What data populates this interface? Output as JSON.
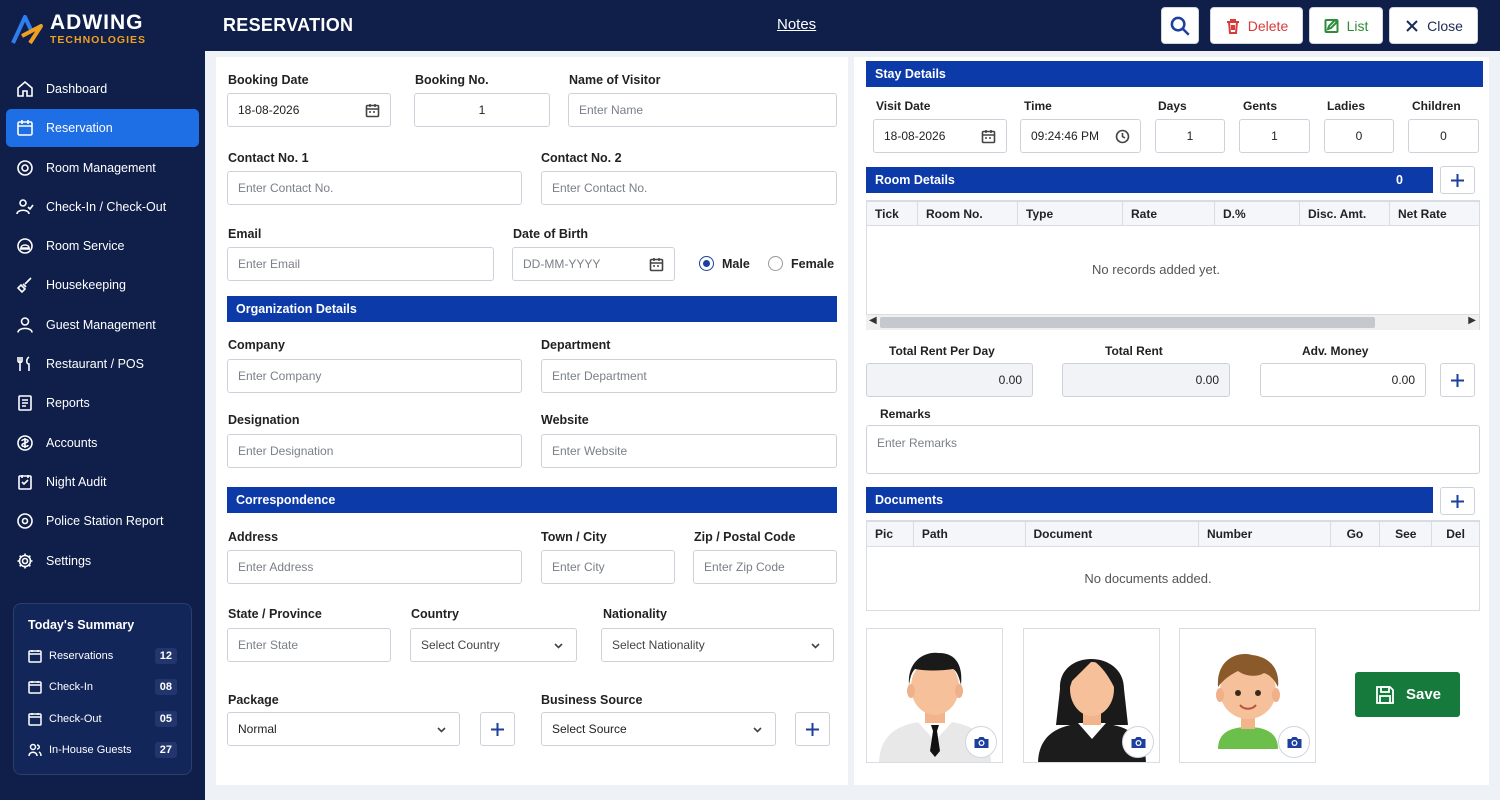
{
  "brand": {
    "name": "ADWING",
    "sub": "TECHNOLOGIES"
  },
  "sidebar": {
    "items": [
      {
        "label": "Dashboard",
        "icon": "home-icon"
      },
      {
        "label": "Reservation",
        "icon": "calendar-icon",
        "active": true
      },
      {
        "label": "Room Management",
        "icon": "room-icon"
      },
      {
        "label": "Check-In / Check-Out",
        "icon": "user-check-icon"
      },
      {
        "label": "Room Service",
        "icon": "service-icon"
      },
      {
        "label": "Housekeeping",
        "icon": "broom-icon"
      },
      {
        "label": "Guest Management",
        "icon": "user-icon"
      },
      {
        "label": "Restaurant / POS",
        "icon": "pos-icon"
      },
      {
        "label": "Reports",
        "icon": "report-icon"
      },
      {
        "label": "Accounts",
        "icon": "accounts-icon"
      },
      {
        "label": "Night Audit",
        "icon": "night-icon"
      },
      {
        "label": "Police Station Report",
        "icon": "police-icon"
      },
      {
        "label": "Settings",
        "icon": "gear-icon"
      }
    ],
    "summary": {
      "title": "Today's Summary",
      "rows": [
        {
          "label": "Reservations",
          "count": "12"
        },
        {
          "label": "Check-In",
          "count": "08"
        },
        {
          "label": "Check-Out",
          "count": "05"
        },
        {
          "label": "In-House Guests",
          "count": "27"
        }
      ]
    }
  },
  "header": {
    "title": "RESERVATION",
    "notes": "Notes",
    "delete": "Delete",
    "list": "List",
    "close": "Close"
  },
  "form": {
    "booking_date": {
      "label": "Booking Date",
      "value": "18-08-2026"
    },
    "booking_no": {
      "label": "Booking No.",
      "value": "1"
    },
    "visitor": {
      "label": "Name of Visitor",
      "placeholder": "Enter Name"
    },
    "contact1": {
      "label": "Contact No. 1",
      "placeholder": "Enter Contact No."
    },
    "contact2": {
      "label": "Contact No. 2",
      "placeholder": "Enter Contact No."
    },
    "email": {
      "label": "Email",
      "placeholder": "Enter Email"
    },
    "dob": {
      "label": "Date of Birth",
      "placeholder": "DD-MM-YYYY"
    },
    "gender": {
      "male": "Male",
      "female": "Female",
      "selected": "Male"
    },
    "org_title": "Organization Details",
    "company": {
      "label": "Company",
      "placeholder": "Enter Company"
    },
    "department": {
      "label": "Department",
      "placeholder": "Enter Department"
    },
    "designation": {
      "label": "Designation",
      "placeholder": "Enter Designation"
    },
    "website": {
      "label": "Website",
      "placeholder": "Enter Website"
    },
    "corr_title": "Correspondence",
    "address": {
      "label": "Address",
      "placeholder": "Enter Address"
    },
    "city": {
      "label": "Town / City",
      "placeholder": "Enter City"
    },
    "zip": {
      "label": "Zip / Postal Code",
      "placeholder": "Enter Zip Code"
    },
    "state": {
      "label": "State / Province",
      "placeholder": "Enter State"
    },
    "country": {
      "label": "Country",
      "value": "Select Country"
    },
    "nationality": {
      "label": "Nationality",
      "value": "Select Nationality"
    },
    "package": {
      "label": "Package",
      "value": "Normal"
    },
    "source": {
      "label": "Business Source",
      "value": "Select Source"
    }
  },
  "stay": {
    "title": "Stay Details",
    "visit_date": {
      "label": "Visit Date",
      "value": "18-08-2026"
    },
    "time": {
      "label": "Time",
      "value": "09:24:46 PM"
    },
    "days": {
      "label": "Days",
      "value": "1"
    },
    "gents": {
      "label": "Gents",
      "value": "1"
    },
    "ladies": {
      "label": "Ladies",
      "value": "0"
    },
    "children": {
      "label": "Children",
      "value": "0"
    }
  },
  "rooms": {
    "title": "Room Details",
    "count": "0",
    "columns": [
      "Tick",
      "Room No.",
      "Type",
      "Rate",
      "D.%",
      "Disc. Amt.",
      "Net Rate"
    ],
    "empty": "No records added yet."
  },
  "totals": {
    "rent_per_day": {
      "label": "Total Rent Per Day",
      "value": "0.00"
    },
    "total_rent": {
      "label": "Total Rent",
      "value": "0.00"
    },
    "adv_money": {
      "label": "Adv. Money",
      "value": "0.00"
    },
    "remarks": {
      "label": "Remarks",
      "placeholder": "Enter Remarks"
    }
  },
  "documents": {
    "title": "Documents",
    "columns": [
      "Pic",
      "Path",
      "Document",
      "Number",
      "Go",
      "See",
      "Del"
    ],
    "empty": "No documents added."
  },
  "save": "Save",
  "colors": {
    "sidebar": "#0f1f4a",
    "accent": "#0d3aa9",
    "active": "#1e6ee6",
    "delete": "#d93a3a",
    "list": "#2e8b3a",
    "save": "#157a3c"
  }
}
